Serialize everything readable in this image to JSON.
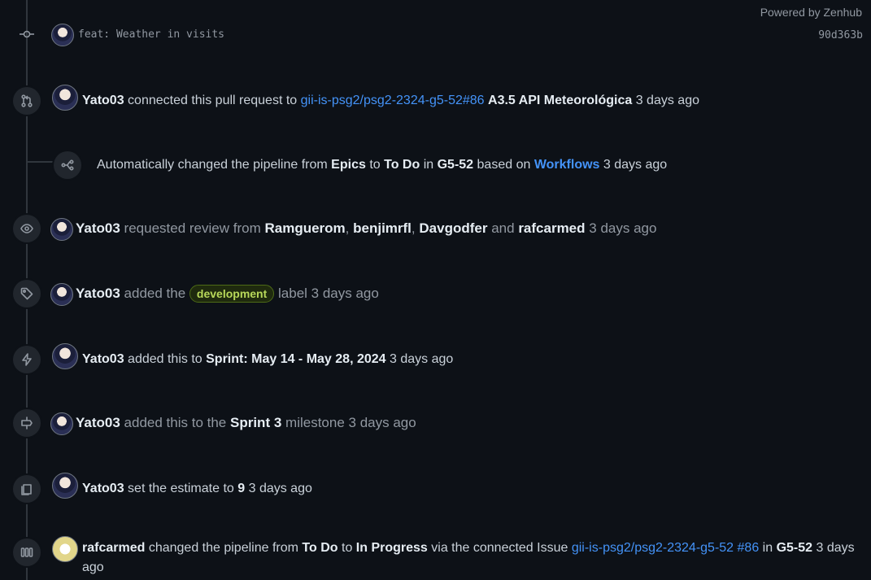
{
  "header": {
    "powered_by": "Powered by Zenhub"
  },
  "commit": {
    "message": "feat: Weather in visits",
    "sha": "90d363b"
  },
  "events": {
    "connected": {
      "user": "Yato03",
      "action": "connected this pull request to",
      "link": "gii-is-psg2/psg2-2324-g5-52#86",
      "issue_title": "A3.5 API Meteorológica",
      "time": "3 days ago"
    },
    "pipeline_auto": {
      "pre": "Automatically changed the pipeline from",
      "from": "Epics",
      "to_word": "to",
      "to": "To Do",
      "in_word": "in",
      "workspace": "G5-52",
      "based": "based on",
      "workflows": "Workflows",
      "time": "3 days ago"
    },
    "review": {
      "user": "Yato03",
      "action": "requested review from",
      "r1": "Ramguerom",
      "sep1": ",",
      "r2": "benjimrfl",
      "sep2": ",",
      "r3": "Davgodfer",
      "and": "and",
      "r4": "rafcarmed",
      "time": "3 days ago"
    },
    "label": {
      "user": "Yato03",
      "action": "added the",
      "label": "development",
      "suffix": "label",
      "time": "3 days ago"
    },
    "sprint": {
      "user": "Yato03",
      "action": "added this to",
      "sprint": "Sprint: May 14 - May 28, 2024",
      "time": "3 days ago"
    },
    "milestone": {
      "user": "Yato03",
      "action": "added this to the",
      "milestone": "Sprint 3",
      "suffix": "milestone",
      "time": "3 days ago"
    },
    "estimate": {
      "user": "Yato03",
      "action": "set the estimate to",
      "value": "9",
      "time": "3 days ago"
    },
    "pipeline_conn": {
      "user": "rafcarmed",
      "action": "changed the pipeline from",
      "from": "To Do",
      "to_word": "to",
      "to": "In Progress",
      "via": "via the connected Issue",
      "link": "gii-is-psg2/psg2-2324-g5-52 #86",
      "in_word": "in",
      "workspace": "G5-52",
      "time_line1": "3 days",
      "time_line2": "ago"
    }
  },
  "icons": {
    "commit": "git-commit-icon",
    "pr": "git-pull-request-icon",
    "workflow": "workflow-icon",
    "eye": "eye-icon",
    "tag": "tag-icon",
    "zap": "zap-icon",
    "milestone": "milestone-icon",
    "estimate": "copy-icon",
    "pipeline": "columns-icon"
  },
  "colors": {
    "background": "#0d1117",
    "link": "#4493f8",
    "muted": "#9198a1",
    "label_text": "#b8d85a",
    "label_border": "#4d6b16"
  }
}
